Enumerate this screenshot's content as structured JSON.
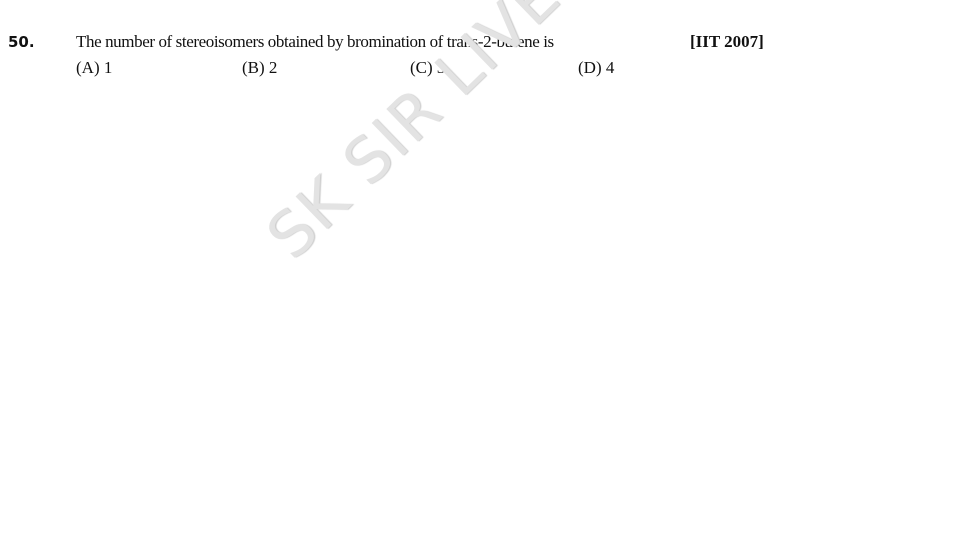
{
  "question": {
    "number": "50.",
    "text": "The number of stereoisomers obtained by bromination of trans-2-butene is",
    "source": "[IIT 2007]",
    "options": [
      {
        "label": "(A)",
        "value": "1"
      },
      {
        "label": "(B)",
        "value": "2"
      },
      {
        "label": "(C)",
        "value": "3"
      },
      {
        "label": "(D)",
        "value": "4"
      }
    ]
  },
  "watermark": {
    "text": "SK SIR LIVE",
    "color": "#e3e3e3"
  }
}
